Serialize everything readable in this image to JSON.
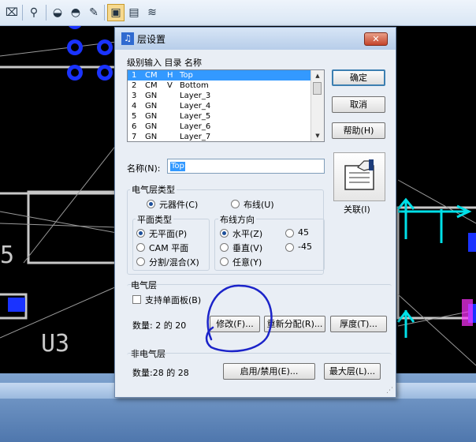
{
  "toolbar": {
    "icons": [
      "pan-icon",
      "zoom-icon",
      "view-icon",
      "view2-icon",
      "brush-icon",
      "layer-tool-icon",
      "window-tool-icon",
      "route-icon"
    ]
  },
  "canvas": {
    "labels": {
      "u3": "U3",
      "five": "5"
    },
    "colors": {
      "outline": "#c8c8c8",
      "pad": "#1a33ff",
      "dimension": "#00e0e8",
      "magenta": "#ff33ff"
    }
  },
  "dialog": {
    "title": "层设置",
    "close_label": "✕",
    "list_header": "级别输入  目录  名称",
    "layers": [
      {
        "num": "1",
        "type": "CM",
        "dir": "H",
        "name": "Top"
      },
      {
        "num": "2",
        "type": "CM",
        "dir": "V",
        "name": "Bottom"
      },
      {
        "num": "3",
        "type": "GN",
        "dir": "",
        "name": "Layer_3"
      },
      {
        "num": "4",
        "type": "GN",
        "dir": "",
        "name": "Layer_4"
      },
      {
        "num": "5",
        "type": "GN",
        "dir": "",
        "name": "Layer_5"
      },
      {
        "num": "6",
        "type": "GN",
        "dir": "",
        "name": "Layer_6"
      },
      {
        "num": "7",
        "type": "GN",
        "dir": "",
        "name": "Layer_7"
      }
    ],
    "buttons": {
      "ok": "确定",
      "cancel": "取消",
      "help": "帮助(H)",
      "associate": "关联(I)",
      "modify": "修改(F)...",
      "reassign": "重新分配(R)...",
      "thickness": "厚度(T)...",
      "enable_disable": "启用/禁用(E)...",
      "max_layers": "最大层(L)..."
    },
    "name_label": "名称(N):",
    "name_value": "Top",
    "electrical_type": {
      "label": "电气层类型",
      "component": "元器件(C)",
      "routing": "布线(U)",
      "selected": "component"
    },
    "plane_type": {
      "label": "平面类型",
      "none": "无平面(P)",
      "cam": "CAM 平面",
      "split": "分割/混合(X)",
      "selected": "none"
    },
    "routing_dir": {
      "label": "布线方向",
      "horizontal": "水平(Z)",
      "vertical": "垂直(V)",
      "any": "任意(Y)",
      "d45": "45",
      "dm45": "-45",
      "selected": "horizontal"
    },
    "electrical_layer": {
      "label": "电气层",
      "single_sided": "支持单面板(B)",
      "single_sided_checked": false,
      "count": "数量: 2 的 20"
    },
    "non_electrical": {
      "label": "非电气层",
      "count": "数量:28 的 28"
    }
  }
}
